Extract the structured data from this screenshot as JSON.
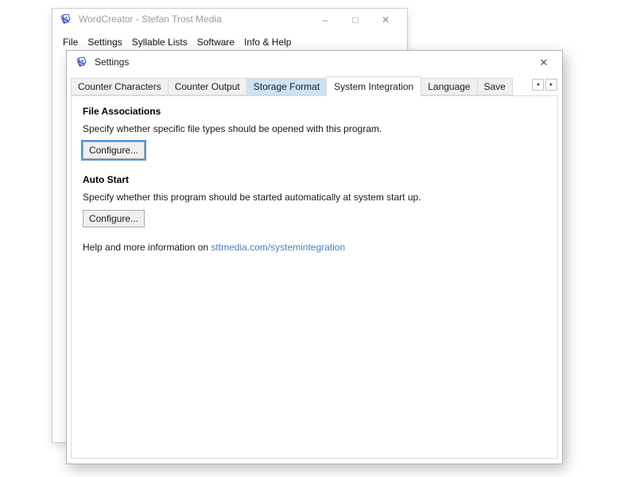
{
  "app_window": {
    "title": "WordCreator - Stefan Trost Media",
    "menu": [
      "File",
      "Settings",
      "Syllable Lists",
      "Software",
      "Info & Help"
    ],
    "window_icons": {
      "minimize": "–",
      "maximize": "□",
      "close": "✕"
    }
  },
  "dialog": {
    "title": "Settings",
    "close_icon": "✕",
    "tab_scroll": {
      "left": "◂",
      "right": "▸"
    },
    "tabs": [
      {
        "label": "Counter Characters",
        "state": "normal"
      },
      {
        "label": "Counter Output",
        "state": "normal"
      },
      {
        "label": "Storage Format",
        "state": "hover"
      },
      {
        "label": "System Integration",
        "state": "selected"
      },
      {
        "label": "Language",
        "state": "normal"
      },
      {
        "label": "Save",
        "state": "normal"
      }
    ],
    "sections": [
      {
        "heading": "File Associations",
        "description": "Specify whether specific file types should be opened with this program.",
        "button_label": "Configure...",
        "focused": true
      },
      {
        "heading": "Auto Start",
        "description": "Specify whether this program should be started automatically at system start up.",
        "button_label": "Configure...",
        "focused": false
      }
    ],
    "help": {
      "text": "Help and more information on ",
      "link": "sttmedia.com/systemintegration"
    }
  },
  "colors": {
    "focus_ring": "#4f96d8",
    "tab_hover": "#cbe3f6",
    "link": "#4a7dbe",
    "inactive_title_text": "#9b9b9b"
  }
}
